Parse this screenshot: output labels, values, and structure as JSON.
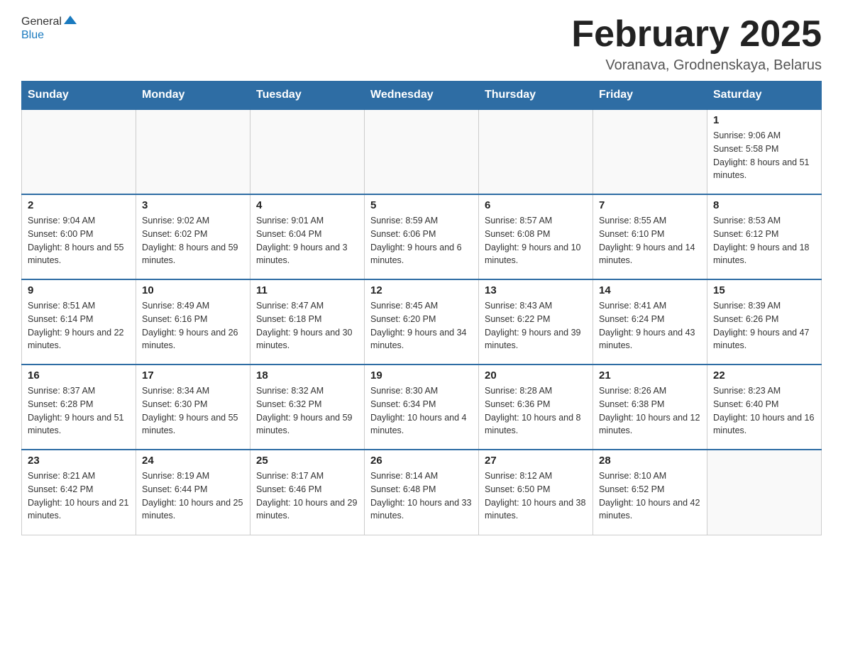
{
  "header": {
    "logo_general": "General",
    "logo_blue": "Blue",
    "month_title": "February 2025",
    "location": "Voranava, Grodnenskaya, Belarus"
  },
  "weekdays": [
    "Sunday",
    "Monday",
    "Tuesday",
    "Wednesday",
    "Thursday",
    "Friday",
    "Saturday"
  ],
  "weeks": [
    [
      {
        "day": "",
        "info": ""
      },
      {
        "day": "",
        "info": ""
      },
      {
        "day": "",
        "info": ""
      },
      {
        "day": "",
        "info": ""
      },
      {
        "day": "",
        "info": ""
      },
      {
        "day": "",
        "info": ""
      },
      {
        "day": "1",
        "info": "Sunrise: 9:06 AM\nSunset: 5:58 PM\nDaylight: 8 hours and 51 minutes."
      }
    ],
    [
      {
        "day": "2",
        "info": "Sunrise: 9:04 AM\nSunset: 6:00 PM\nDaylight: 8 hours and 55 minutes."
      },
      {
        "day": "3",
        "info": "Sunrise: 9:02 AM\nSunset: 6:02 PM\nDaylight: 8 hours and 59 minutes."
      },
      {
        "day": "4",
        "info": "Sunrise: 9:01 AM\nSunset: 6:04 PM\nDaylight: 9 hours and 3 minutes."
      },
      {
        "day": "5",
        "info": "Sunrise: 8:59 AM\nSunset: 6:06 PM\nDaylight: 9 hours and 6 minutes."
      },
      {
        "day": "6",
        "info": "Sunrise: 8:57 AM\nSunset: 6:08 PM\nDaylight: 9 hours and 10 minutes."
      },
      {
        "day": "7",
        "info": "Sunrise: 8:55 AM\nSunset: 6:10 PM\nDaylight: 9 hours and 14 minutes."
      },
      {
        "day": "8",
        "info": "Sunrise: 8:53 AM\nSunset: 6:12 PM\nDaylight: 9 hours and 18 minutes."
      }
    ],
    [
      {
        "day": "9",
        "info": "Sunrise: 8:51 AM\nSunset: 6:14 PM\nDaylight: 9 hours and 22 minutes."
      },
      {
        "day": "10",
        "info": "Sunrise: 8:49 AM\nSunset: 6:16 PM\nDaylight: 9 hours and 26 minutes."
      },
      {
        "day": "11",
        "info": "Sunrise: 8:47 AM\nSunset: 6:18 PM\nDaylight: 9 hours and 30 minutes."
      },
      {
        "day": "12",
        "info": "Sunrise: 8:45 AM\nSunset: 6:20 PM\nDaylight: 9 hours and 34 minutes."
      },
      {
        "day": "13",
        "info": "Sunrise: 8:43 AM\nSunset: 6:22 PM\nDaylight: 9 hours and 39 minutes."
      },
      {
        "day": "14",
        "info": "Sunrise: 8:41 AM\nSunset: 6:24 PM\nDaylight: 9 hours and 43 minutes."
      },
      {
        "day": "15",
        "info": "Sunrise: 8:39 AM\nSunset: 6:26 PM\nDaylight: 9 hours and 47 minutes."
      }
    ],
    [
      {
        "day": "16",
        "info": "Sunrise: 8:37 AM\nSunset: 6:28 PM\nDaylight: 9 hours and 51 minutes."
      },
      {
        "day": "17",
        "info": "Sunrise: 8:34 AM\nSunset: 6:30 PM\nDaylight: 9 hours and 55 minutes."
      },
      {
        "day": "18",
        "info": "Sunrise: 8:32 AM\nSunset: 6:32 PM\nDaylight: 9 hours and 59 minutes."
      },
      {
        "day": "19",
        "info": "Sunrise: 8:30 AM\nSunset: 6:34 PM\nDaylight: 10 hours and 4 minutes."
      },
      {
        "day": "20",
        "info": "Sunrise: 8:28 AM\nSunset: 6:36 PM\nDaylight: 10 hours and 8 minutes."
      },
      {
        "day": "21",
        "info": "Sunrise: 8:26 AM\nSunset: 6:38 PM\nDaylight: 10 hours and 12 minutes."
      },
      {
        "day": "22",
        "info": "Sunrise: 8:23 AM\nSunset: 6:40 PM\nDaylight: 10 hours and 16 minutes."
      }
    ],
    [
      {
        "day": "23",
        "info": "Sunrise: 8:21 AM\nSunset: 6:42 PM\nDaylight: 10 hours and 21 minutes."
      },
      {
        "day": "24",
        "info": "Sunrise: 8:19 AM\nSunset: 6:44 PM\nDaylight: 10 hours and 25 minutes."
      },
      {
        "day": "25",
        "info": "Sunrise: 8:17 AM\nSunset: 6:46 PM\nDaylight: 10 hours and 29 minutes."
      },
      {
        "day": "26",
        "info": "Sunrise: 8:14 AM\nSunset: 6:48 PM\nDaylight: 10 hours and 33 minutes."
      },
      {
        "day": "27",
        "info": "Sunrise: 8:12 AM\nSunset: 6:50 PM\nDaylight: 10 hours and 38 minutes."
      },
      {
        "day": "28",
        "info": "Sunrise: 8:10 AM\nSunset: 6:52 PM\nDaylight: 10 hours and 42 minutes."
      },
      {
        "day": "",
        "info": ""
      }
    ]
  ]
}
